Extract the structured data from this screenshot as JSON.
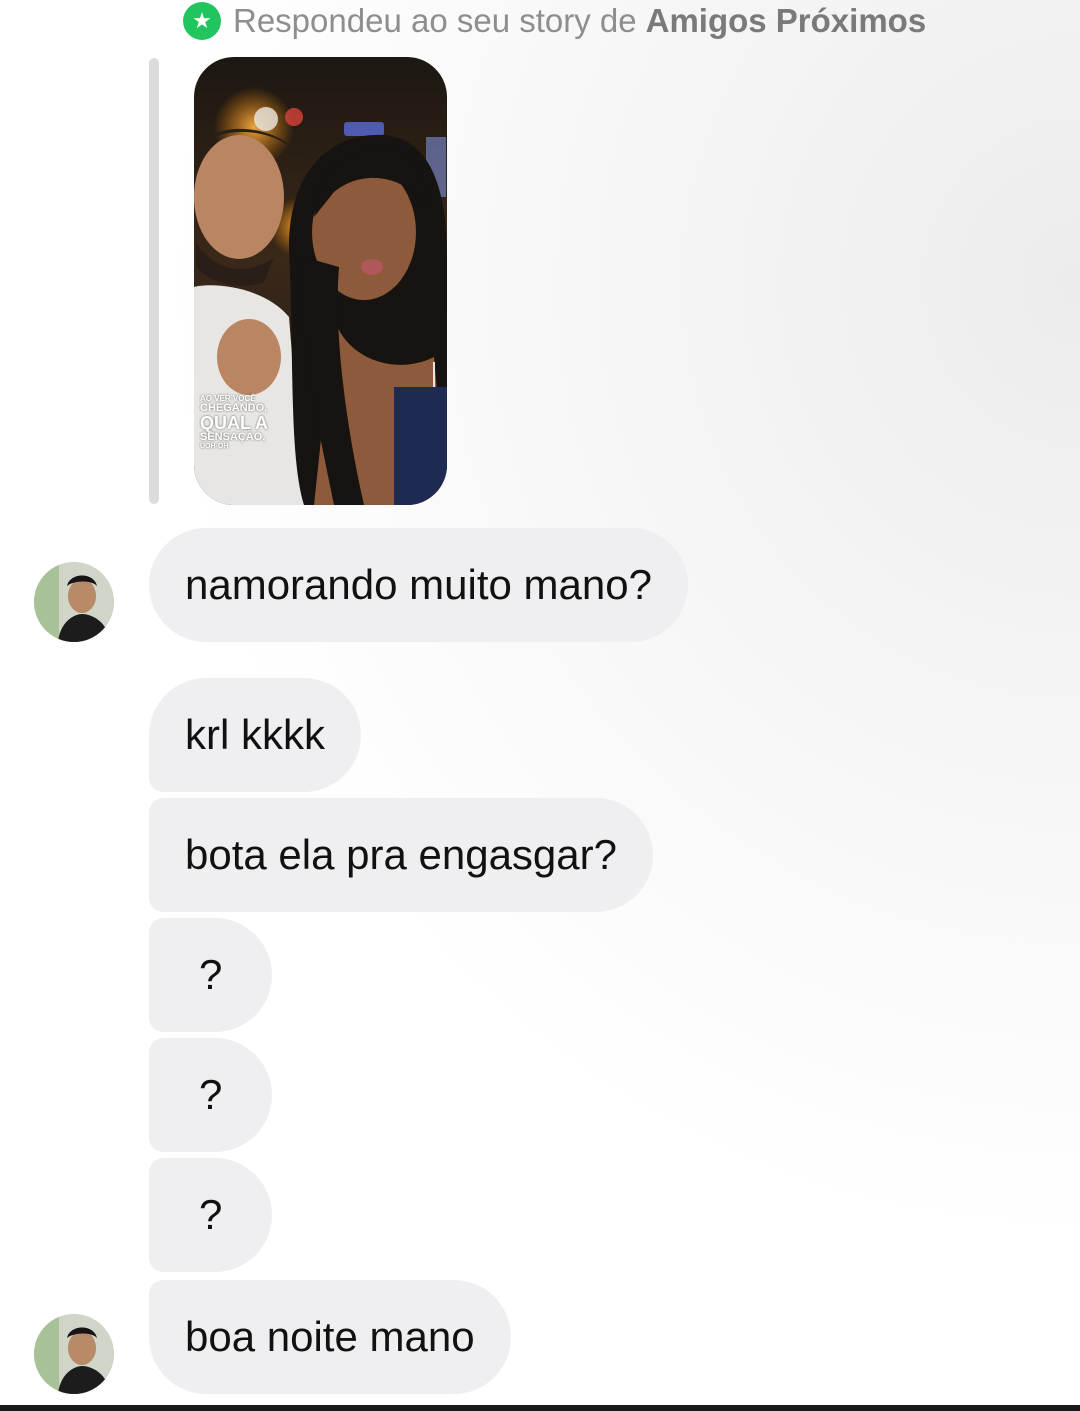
{
  "reply_header": {
    "prefix": "Respondeu ao seu story de",
    "audience": "Amigos Próximos",
    "badge_icon": "green-star-badge",
    "badge_color": "#21c55d"
  },
  "story": {
    "caption_line1": "AO VER VOCÊ",
    "caption_line2": "CHEGANDO,",
    "caption_line3": "QUAL A",
    "caption_line4": "SENSAÇÃO,",
    "caption_line5": "UOH-OH"
  },
  "messages": [
    {
      "text": "namorando muito mano?"
    },
    {
      "text": "krl kkkk"
    },
    {
      "text": "bota ela pra engasgar?"
    },
    {
      "text": "?"
    },
    {
      "text": "?"
    },
    {
      "text": "?"
    },
    {
      "text": "boa noite mano"
    }
  ],
  "colors": {
    "bubble_bg": "#efeff1",
    "text": "#111111",
    "header_text": "#8e8e8e"
  }
}
